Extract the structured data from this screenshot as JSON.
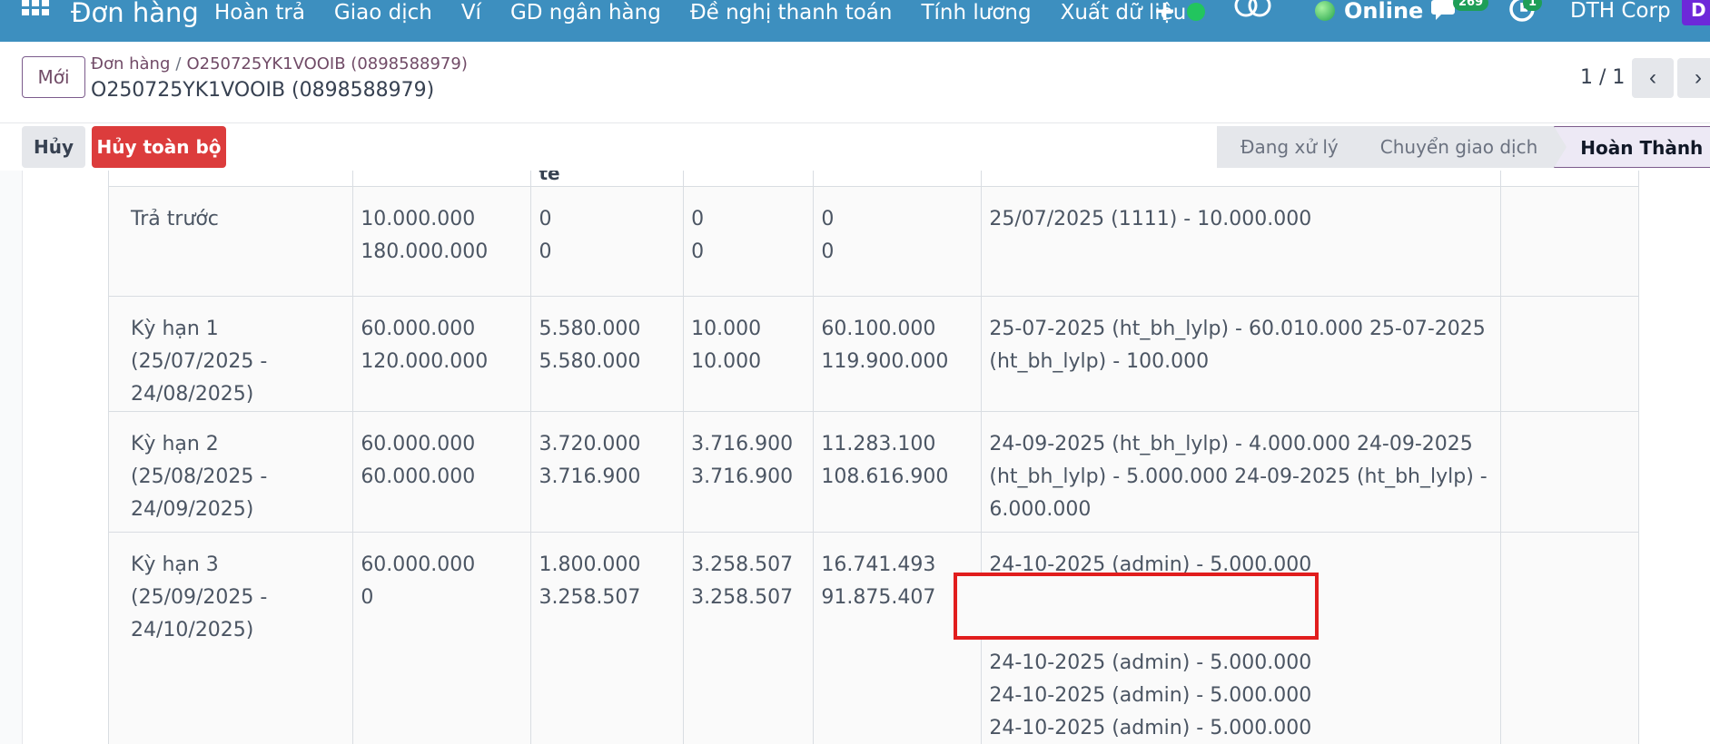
{
  "navbar": {
    "app_name": "Đơn hàng",
    "menu": [
      "Hoàn trả",
      "Giao dịch",
      "Ví",
      "GD ngân hàng",
      "Đề nghị thanh toán",
      "Tính lương",
      "Xuất dữ liệu"
    ],
    "status_text": "Online",
    "messages_count": "269",
    "activities_count": "1",
    "company": "DTH Corp",
    "avatar_initial": "D"
  },
  "control_panel": {
    "new_label": "Mới",
    "breadcrumb_parent": "Đơn hàng",
    "breadcrumb_separator": "/",
    "breadcrumb_current": "O250725YK1VOOIB (0898588979)",
    "record_title": "O250725YK1VOOIB (0898588979)",
    "pager_value": "1 / 1",
    "pager_prev": "‹",
    "pager_next": "›"
  },
  "actions": {
    "cancel_label": "Hủy",
    "cancel_all_label": "Hủy toàn bộ"
  },
  "statusbar": {
    "steps": [
      "Đang xử lý",
      "Chuyển giao dịch",
      "Hoàn Thành"
    ],
    "active": "Hoàn Thành"
  },
  "table": {
    "header_fragment": "tế",
    "rows": [
      {
        "period": "Trả trước",
        "c1": [
          "10.000.000",
          "180.000.000"
        ],
        "c2": [
          "0",
          "0"
        ],
        "c3": [
          "0",
          "0"
        ],
        "c4": [
          "0",
          "0"
        ],
        "history": "25/07/2025 (1111) - 10.000.000"
      },
      {
        "period": "Kỳ hạn 1 (25/07/2025 - 24/08/2025)",
        "c1": [
          "60.000.000",
          "120.000.000"
        ],
        "c2": [
          "5.580.000",
          "5.580.000"
        ],
        "c3": [
          "10.000",
          "10.000"
        ],
        "c4": [
          "60.100.000",
          "119.900.000"
        ],
        "history": "25-07-2025 (ht_bh_lylp) - 60.010.000 25-07-2025 (ht_bh_lylp) - 100.000"
      },
      {
        "period": "Kỳ hạn 2 (25/08/2025 - 24/09/2025)",
        "c1": [
          "60.000.000",
          "60.000.000"
        ],
        "c2": [
          "3.720.000",
          "3.716.900"
        ],
        "c3": [
          "3.716.900",
          "3.716.900"
        ],
        "c4": [
          "11.283.100",
          "108.616.900"
        ],
        "history": "24-09-2025 (ht_bh_lylp) - 4.000.000 24-09-2025 (ht_bh_lylp) - 5.000.000 24-09-2025 (ht_bh_lylp) - 6.000.000"
      },
      {
        "period": "Kỳ hạn 3 (25/09/2025 - 24/10/2025)",
        "c1": [
          "60.000.000",
          "0"
        ],
        "c2": [
          "1.800.000",
          "3.258.507"
        ],
        "c3": [
          "3.258.507",
          "3.258.507"
        ],
        "c4": [
          "16.741.493",
          "91.875.407"
        ],
        "history_lines": [
          "24-10-2025 (admin) - 5.000.000",
          "",
          "",
          "24-10-2025 (admin) - 5.000.000",
          "24-10-2025 (admin) - 5.000.000",
          "24-10-2025 (admin) - 5.000.000"
        ]
      }
    ]
  },
  "colors": {
    "navbar": "#3d8fbf",
    "primary": "#714b67",
    "danger": "#dc3c3c",
    "highlight": "#e11d1d",
    "badge": "#1e9e57"
  }
}
